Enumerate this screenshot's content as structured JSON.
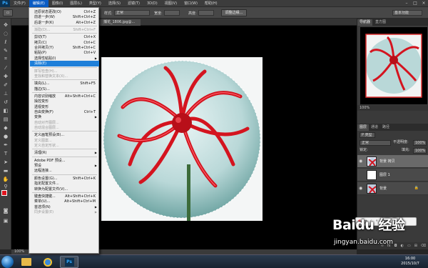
{
  "menubar": {
    "logo": "Ps",
    "items": [
      "文件(F)",
      "编辑(E)",
      "图像(I)",
      "图层(L)",
      "类型(Y)",
      "选择(S)",
      "滤镜(T)",
      "3D(D)",
      "视图(V)",
      "窗口(W)",
      "帮助(H)"
    ],
    "active_index": 1
  },
  "options": {
    "style_label": "样式:",
    "style_value": "正常",
    "width_label": "宽度:",
    "height_label": "高度:",
    "refine_button": "调整边缘...",
    "workspace": "基本功能"
  },
  "document": {
    "tab_title": "捕花_1806.jpg@...",
    "status": "100%"
  },
  "edit_menu": {
    "items": [
      {
        "label": "还原状态更改(O)",
        "shortcut": "Ctrl+Z"
      },
      {
        "label": "前进一步(W)",
        "shortcut": "Shift+Ctrl+Z"
      },
      {
        "label": "后退一步(K)",
        "shortcut": "Alt+Ctrl+Z"
      },
      {
        "sep": true
      },
      {
        "label": "渐隐(D)...",
        "shortcut": "Shift+Ctrl+F",
        "disabled": true
      },
      {
        "sep": true
      },
      {
        "label": "剪切(T)",
        "shortcut": "Ctrl+X"
      },
      {
        "label": "拷贝(C)",
        "shortcut": "Ctrl+C"
      },
      {
        "label": "合并拷贝(Y)",
        "shortcut": "Shift+Ctrl+C"
      },
      {
        "label": "粘贴(P)",
        "shortcut": "Ctrl+V"
      },
      {
        "label": "选择性粘贴(I)",
        "submenu": true
      },
      {
        "label": "清除(E)",
        "highlighted": true
      },
      {
        "sep": true
      },
      {
        "label": "拼写检查(H)...",
        "disabled": true
      },
      {
        "label": "查找和替换文本(X)...",
        "disabled": true
      },
      {
        "sep": true
      },
      {
        "label": "填充(L)...",
        "shortcut": "Shift+F5"
      },
      {
        "label": "描边(S)..."
      },
      {
        "sep": true
      },
      {
        "label": "内容识别缩放",
        "shortcut": "Alt+Shift+Ctrl+C"
      },
      {
        "label": "操控变形"
      },
      {
        "label": "透视变形"
      },
      {
        "label": "自由变换(F)",
        "shortcut": "Ctrl+T"
      },
      {
        "label": "变换",
        "submenu": true
      },
      {
        "label": "自动对齐图层...",
        "disabled": true
      },
      {
        "label": "自动混合图层...",
        "disabled": true
      },
      {
        "sep": true
      },
      {
        "label": "定义画笔预设(B)..."
      },
      {
        "label": "定义图案...",
        "disabled": true
      },
      {
        "label": "定义自定形状...",
        "disabled": true
      },
      {
        "sep": true
      },
      {
        "label": "清理(R)",
        "submenu": true
      },
      {
        "sep": true
      },
      {
        "label": "Adobe PDF 预设..."
      },
      {
        "label": "预设",
        "submenu": true
      },
      {
        "label": "远程连接..."
      },
      {
        "sep": true
      },
      {
        "label": "颜色设置(G)...",
        "shortcut": "Shift+Ctrl+K"
      },
      {
        "label": "指定配置文件..."
      },
      {
        "label": "转换为配置文件(V)..."
      },
      {
        "sep": true
      },
      {
        "label": "键盘快捷键...",
        "shortcut": "Alt+Shift+Ctrl+K"
      },
      {
        "label": "菜单(U)...",
        "shortcut": "Alt+Shift+Ctrl+M"
      },
      {
        "label": "首选项(N)",
        "submenu": true
      },
      {
        "label": "同步设置(E)",
        "submenu": true,
        "disabled": true
      }
    ]
  },
  "navigator": {
    "tabs": [
      "导航器",
      "直方图"
    ],
    "zoom": "100%"
  },
  "layers": {
    "tabs": [
      "图层",
      "通道",
      "路径"
    ],
    "kind": "P 类型",
    "blend_mode": "正常",
    "opacity_label": "不透明度:",
    "opacity_value": "100%",
    "lock_label": "锁定:",
    "fill_label": "填充:",
    "fill_value": "100%",
    "items": [
      {
        "name": "背景 拷贝",
        "selected": true,
        "visible": true
      },
      {
        "name": "图层 1",
        "selected": false,
        "visible": false
      },
      {
        "name": "背景",
        "selected": false,
        "visible": true,
        "locked": true
      }
    ]
  },
  "taskbar": {
    "clock_time": "16:00",
    "clock_date": "2015/10/7"
  },
  "watermark": {
    "logo": "Baidu 经验",
    "url": "jingyan.baidu.com"
  },
  "ime": {
    "label": "英"
  }
}
